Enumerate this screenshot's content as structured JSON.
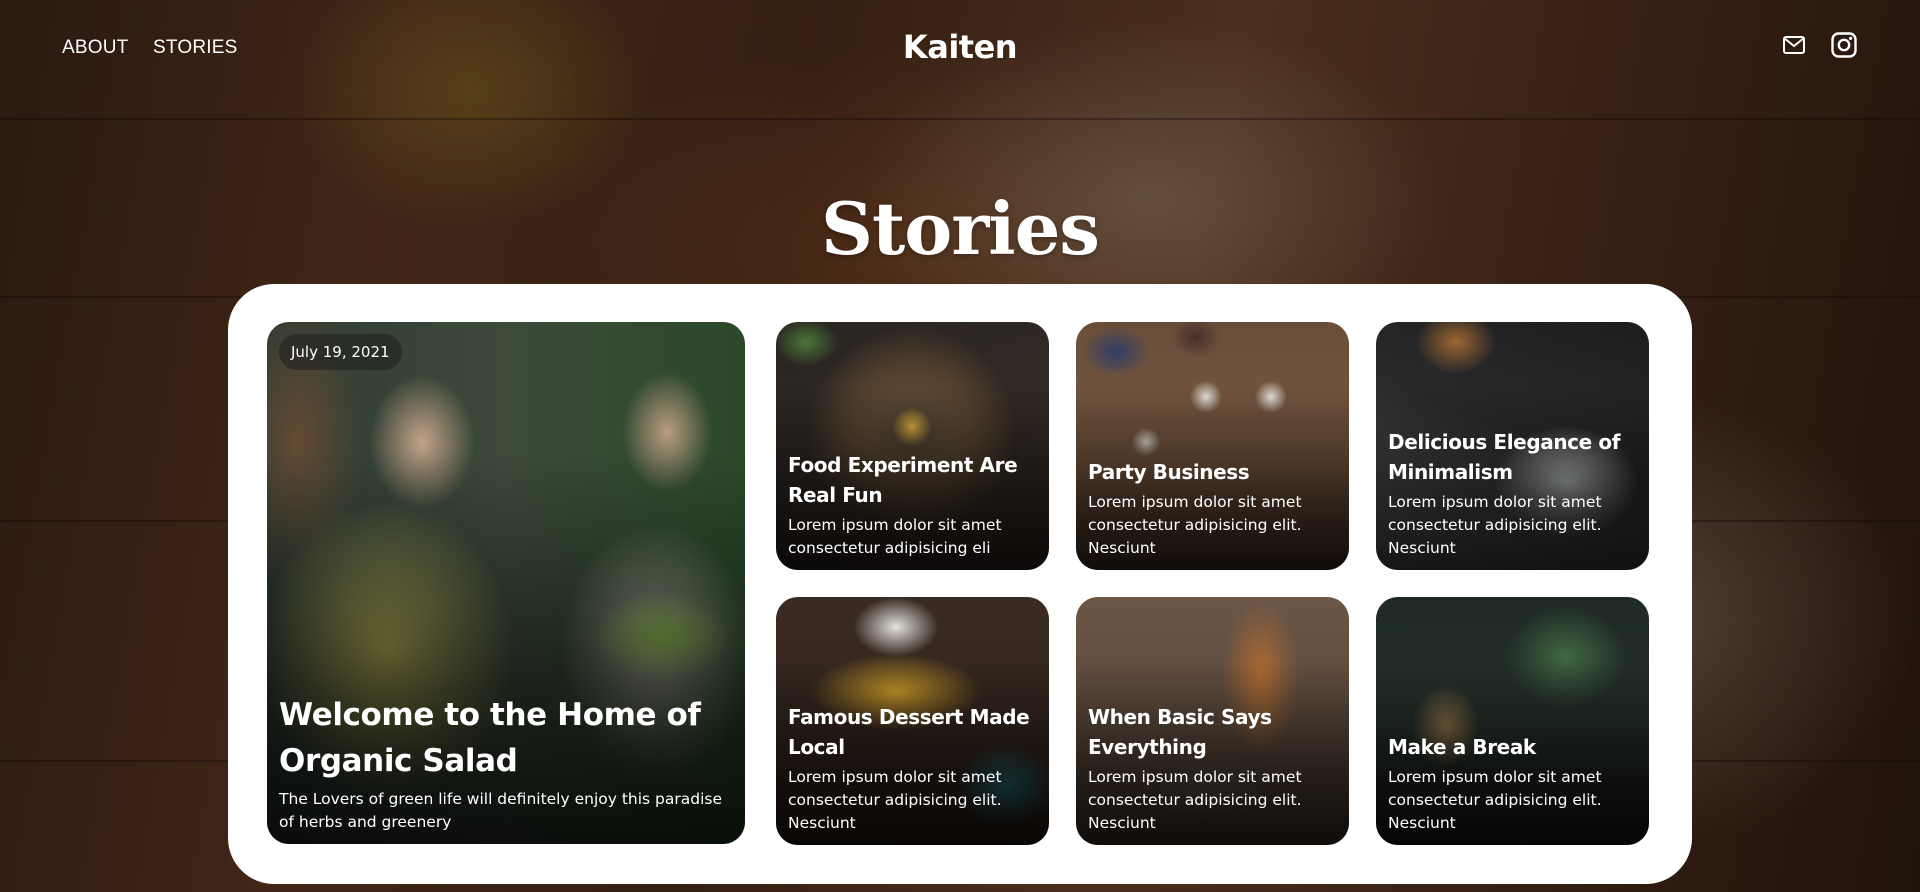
{
  "nav": {
    "links": [
      "ABOUT",
      "STORIES"
    ],
    "brand": "Kaiten",
    "icons": [
      "mail-icon",
      "instagram-icon"
    ]
  },
  "page": {
    "title": "Stories"
  },
  "featured": {
    "date": "July 19, 2021",
    "title": "Welcome to the Home of Organic Salad",
    "excerpt": "The Lovers of green life will definitely enjoy this paradise of herbs and greenery"
  },
  "stories": [
    {
      "title": "Food Experiment Are Real Fun",
      "excerpt": "Lorem ipsum dolor sit amet consectetur adipisicing eli"
    },
    {
      "title": "Party Business",
      "excerpt": "Lorem ipsum dolor sit amet consectetur adipisicing elit. Nesciunt"
    },
    {
      "title": "Delicious Elegance of Minimalism",
      "excerpt": "Lorem ipsum dolor sit amet consectetur adipisicing elit. Nesciunt"
    },
    {
      "title": "Famous Dessert Made Local",
      "excerpt": "Lorem ipsum dolor sit amet consectetur adipisicing elit. Nesciunt"
    },
    {
      "title": "When Basic Says Everything",
      "excerpt": "Lorem ipsum dolor sit amet consectetur adipisicing elit. Nesciunt"
    },
    {
      "title": "Make a Break",
      "excerpt": "Lorem ipsum dolor sit amet consectetur adipisicing elit. Nesciunt"
    }
  ]
}
